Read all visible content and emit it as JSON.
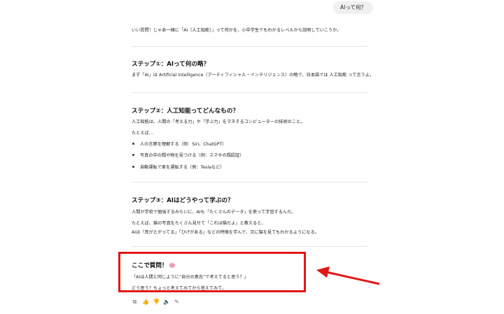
{
  "user_message": "AIって何？",
  "intro": "いい質問！じゃあ一緒に「AI（人工知能）」って何かを、小中学生でもわかるレベルから説明していこうか。",
  "step1": {
    "title": "ステップ①：AIって何の略？",
    "body": "まず「AI」は Artificial Intelligence（アーティフィシャル・インテリジェンス）の略で、日本語では 人工知能 って言うよ。"
  },
  "step2": {
    "title": "ステップ②：人工知能ってどんなもの？",
    "body": "人工知能は、人間の「考える力」や「学ぶ力」をマネするコンピューターの技術のこと。",
    "examples_label": "たとえば…",
    "bullets": [
      "人の言葉を理解する（例：Siri、ChatGPT）",
      "写真の中の顔や物を見つける（例：スマホの顔認証）",
      "自動運転で車を運転する（例：Teslaなど）"
    ]
  },
  "step3": {
    "title": "ステップ③：AIはどうやって学ぶの？",
    "body": "人間が学校で勉強するみたいに、AIも「たくさんのデータ」を使って学習するんだ。",
    "line2": "たとえば、猫の写真をたくさん見せて「これは猫だよ」と教えると、",
    "line3": "AIは「耳がとがってる」「ひげがある」などの特徴を学んで、次に猫を見てもわかるようになる。"
  },
  "question": {
    "title": "ここで質問！",
    "quote": "「AIは人間と同じように“自分の意志”で考えてると思う？」",
    "prompt": "どう思う？ちょっと考えてみてから答えてみて。"
  },
  "icons": [
    "copy-icon",
    "thumbs-up-icon",
    "thumbs-down-icon",
    "speaker-icon",
    "edit-icon"
  ],
  "colors": {
    "highlight": "#e01818",
    "brain": "#f49ac1"
  }
}
